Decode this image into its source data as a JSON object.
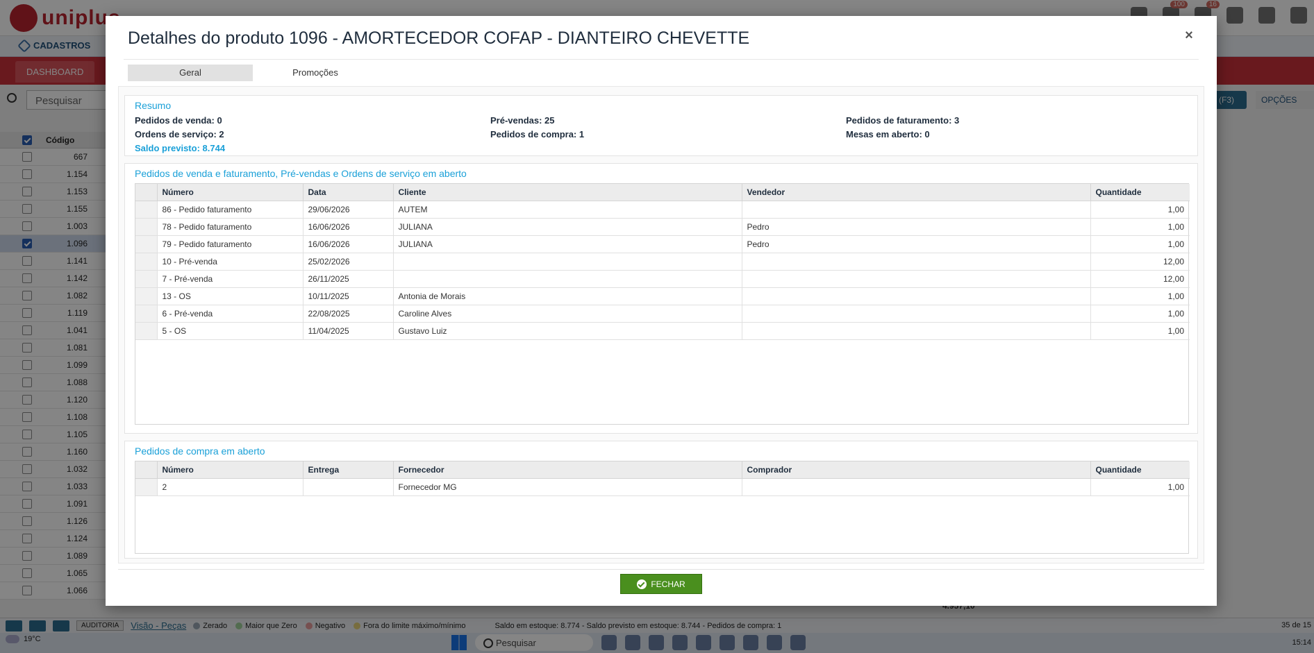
{
  "app": {
    "logo_text": "uniplus",
    "badges": [
      "100",
      "16"
    ],
    "nav_label": "CADASTROS",
    "tab_dashboard": "DASHBOARD",
    "search_placeholder": "Pesquisar",
    "btn_f3": "R (F3)",
    "btn_opcoes": "OPÇÕES",
    "left_table": {
      "header": "Código",
      "codes": [
        "667",
        "1.154",
        "1.153",
        "1.155",
        "1.003",
        "1.096",
        "1.141",
        "1.142",
        "1.082",
        "1.119",
        "1.041",
        "1.081",
        "1.099",
        "1.088",
        "1.120",
        "1.108",
        "1.105",
        "1.160",
        "1.032",
        "1.033",
        "1.091",
        "1.126",
        "1.124",
        "1.089",
        "1.065",
        "1.066"
      ],
      "selected_code": "1.096"
    },
    "sum_value": "4.957,10",
    "status": {
      "auditoria": "AUDITORIA",
      "visao": "Visão - Peças",
      "legend": [
        {
          "label": "Zerado",
          "color": "#9aa7b5"
        },
        {
          "label": "Maior que Zero",
          "color": "#9fd09a"
        },
        {
          "label": "Negativo",
          "color": "#e59a9a"
        },
        {
          "label": "Fora do limite máximo/mínimo",
          "color": "#e6d27a"
        }
      ],
      "stock_text": "Saldo em estoque: 8.774 - Saldo previsto em estoque: 8.744 - Pedidos de compra: 1",
      "pager": "35 de 15"
    },
    "taskbar": {
      "temperature": "19°C",
      "search": "Pesquisar",
      "time": "15:14"
    }
  },
  "modal": {
    "title": "Detalhes do produto 1096 - AMORTECEDOR COFAP - DIANTEIRO CHEVETTE",
    "close_label": "×",
    "tabs": [
      {
        "label": "Geral",
        "active": true
      },
      {
        "label": "Promoções",
        "active": false
      }
    ],
    "summary": {
      "title": "Resumo",
      "pedidos_venda": "Pedidos de venda: 0",
      "ordens_servico": "Ordens de serviço: 2",
      "saldo_previsto": "Saldo previsto: 8.744",
      "pre_vendas": "Pré-vendas: 25",
      "pedidos_compra": "Pedidos de compra: 1",
      "pedidos_faturamento": "Pedidos de faturamento: 3",
      "mesas_aberto": "Mesas em aberto: 0"
    },
    "orders": {
      "title": "Pedidos de venda e faturamento, Pré-vendas e Ordens de serviço em aberto",
      "columns": [
        "Número",
        "Data",
        "Cliente",
        "Vendedor",
        "Quantidade"
      ],
      "rows": [
        [
          "86 - Pedido faturamento",
          "29/06/2026",
          "AUTEM",
          "",
          "1,00"
        ],
        [
          "78 - Pedido faturamento",
          "16/06/2026",
          "JULIANA",
          "Pedro",
          "1,00"
        ],
        [
          "79 - Pedido faturamento",
          "16/06/2026",
          "JULIANA",
          "Pedro",
          "1,00"
        ],
        [
          "10 - Pré-venda",
          "25/02/2026",
          "",
          "",
          "12,00"
        ],
        [
          "7 - Pré-venda",
          "26/11/2025",
          "",
          "",
          "12,00"
        ],
        [
          "13 - OS",
          "10/11/2025",
          "Antonia de Morais",
          "",
          "1,00"
        ],
        [
          "6 - Pré-venda",
          "22/08/2025",
          "Caroline Alves",
          "",
          "1,00"
        ],
        [
          "5 - OS",
          "11/04/2025",
          "Gustavo Luiz",
          "",
          "1,00"
        ]
      ]
    },
    "purchases": {
      "title": "Pedidos de compra em aberto",
      "columns": [
        "Número",
        "Entrega",
        "Fornecedor",
        "Comprador",
        "Quantidade"
      ],
      "rows": [
        [
          "2",
          "",
          "Fornecedor MG",
          "",
          "1,00"
        ]
      ]
    },
    "close_button": "FECHAR",
    "accent_color": "#1aa0d8",
    "button_color": "#4a8f1e"
  }
}
